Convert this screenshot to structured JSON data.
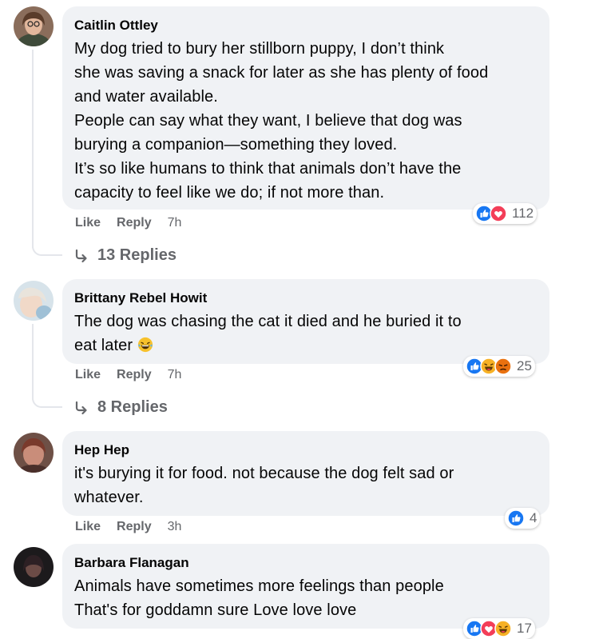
{
  "comments": [
    {
      "author": "Caitlin Ottley",
      "lines": [
        "My dog tried to bury her stillborn puppy, I don’t think",
        "she was saving a snack for later as she has plenty of food",
        "and water available.",
        "People can say what they want, I believe that dog was",
        "burying a companion—something they loved.",
        "It’s so like humans to think that animals don’t have the",
        "capacity to feel like we do; if not more than."
      ],
      "reactions": [
        "like-icon",
        "love-icon"
      ],
      "reaction_count": "112",
      "like_label": "Like",
      "reply_label": "Reply",
      "time": "7h",
      "replies_label": "13 Replies"
    },
    {
      "author": "Brittany Rebel Howit",
      "lines": [
        "The dog was chasing the cat it died and he buried it to",
        "eat later"
      ],
      "inline_emoji": "laughing-crying-emoji",
      "reactions": [
        "like-icon",
        "haha-icon",
        "angry-icon"
      ],
      "reaction_count": "25",
      "like_label": "Like",
      "reply_label": "Reply",
      "time": "7h",
      "replies_label": "8 Replies"
    },
    {
      "author": "Hep Hep",
      "lines": [
        "it's burying it for food. not because the dog felt sad or",
        "whatever."
      ],
      "reactions": [
        "like-icon"
      ],
      "reaction_count": "4",
      "like_label": "Like",
      "reply_label": "Reply",
      "time": "3h"
    },
    {
      "author": "Barbara Flanagan",
      "lines": [
        "Animals have sometimes more feelings than people",
        "That's for goddamn sure Love love love"
      ],
      "reactions": [
        "like-icon",
        "love-icon",
        "haha-icon"
      ],
      "reaction_count": "17"
    }
  ],
  "colors": {
    "bubble": "#f0f2f5",
    "meta_text": "#65676b",
    "like_blue": "#1877f2",
    "love_red": "#f33e58",
    "haha_yellow": "#f7b125",
    "angry_orange": "#e9710f"
  }
}
